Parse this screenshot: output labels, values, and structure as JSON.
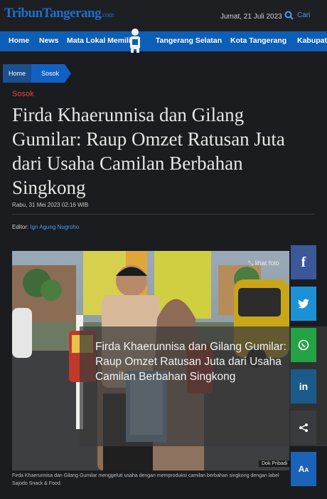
{
  "header": {
    "logo_main": "TribunTangerang",
    "logo_domain": ".com",
    "date": "Jumat, 21 Juli 2023",
    "search_label": "Cari"
  },
  "nav": {
    "items": [
      "Home",
      "News",
      "Mata Lokal Memilih",
      "Tangerang Selatan",
      "Kota Tangerang",
      "Kabupaten"
    ]
  },
  "breadcrumb": [
    "Home",
    "Sosok"
  ],
  "article": {
    "category": "Sosok",
    "title": "Firda Khaerunnisa dan Gilang Gumilar: Raup Omzet Ratusan Juta dari Usaha Camilan Berbahan Singkong",
    "date": "Rabu, 31 Mei 2023 02:16 WIB",
    "editor_label": "Editor:",
    "editor_name": "Ign Agung Nugroho",
    "photo_link": "lihat foto",
    "photo_credit": "Dok Pribadi",
    "caption": "Firda Khaerunnisa dan Gilang Gumilar menggeluti usaha dengan memproduksi camilan berbahan singkong dengan label Sajodo Snack & Food.",
    "overlay_title": "Firda Khaerunnisa dan Gilang Gumilar: Raup Omzet Ratusan Juta dari Usaha Camilan Berbahan Singkong"
  },
  "share": [
    {
      "icon": "facebook-icon",
      "color": "#3b5998",
      "glyph": "f"
    },
    {
      "icon": "twitter-icon",
      "color": "#1da1f2",
      "glyph": "🐦"
    },
    {
      "icon": "whatsapp-icon",
      "color": "#25a244",
      "glyph": "✆"
    },
    {
      "icon": "linkedin-icon",
      "color": "#1b5b8a",
      "glyph": "in"
    },
    {
      "icon": "share-icon",
      "color": "#3a3b3e",
      "glyph": "⋖"
    },
    {
      "icon": "font-size-icon",
      "color": "#1a63b8",
      "glyph": "AA"
    }
  ]
}
